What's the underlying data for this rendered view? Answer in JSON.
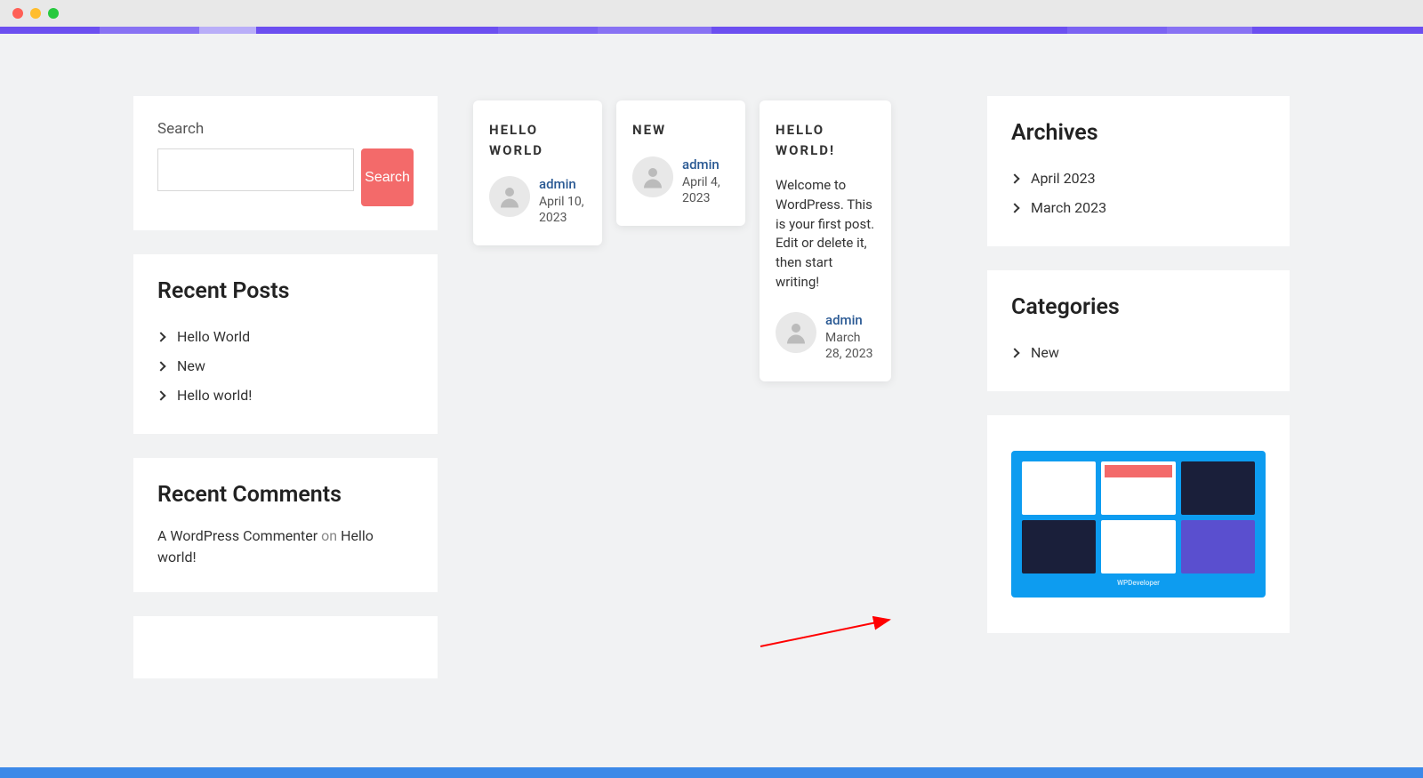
{
  "left": {
    "search_label": "Search",
    "search_button": "Search",
    "recent_posts_title": "Recent Posts",
    "recent_posts": [
      "Hello World",
      "New",
      "Hello world!"
    ],
    "recent_comments_title": "Recent Comments",
    "comments": [
      {
        "author": "A WordPress Commenter",
        "on": " on ",
        "post": "Hello world!"
      }
    ]
  },
  "posts": [
    {
      "title": "HELLO WORLD",
      "author": "admin",
      "date": "April 10, 2023"
    },
    {
      "title": "NEW",
      "author": "admin",
      "date": "April 4, 2023"
    },
    {
      "title": "HELLO WORLD!",
      "excerpt": "Welcome to WordPress. This is your first post. Edit or delete it, then start writing!",
      "author": "admin",
      "date": "March 28, 2023"
    }
  ],
  "right": {
    "archives_title": "Archives",
    "archives": [
      "April 2023",
      "March 2023"
    ],
    "categories_title": "Categories",
    "categories": [
      "New"
    ],
    "template_footer": "WPDeveloper"
  }
}
